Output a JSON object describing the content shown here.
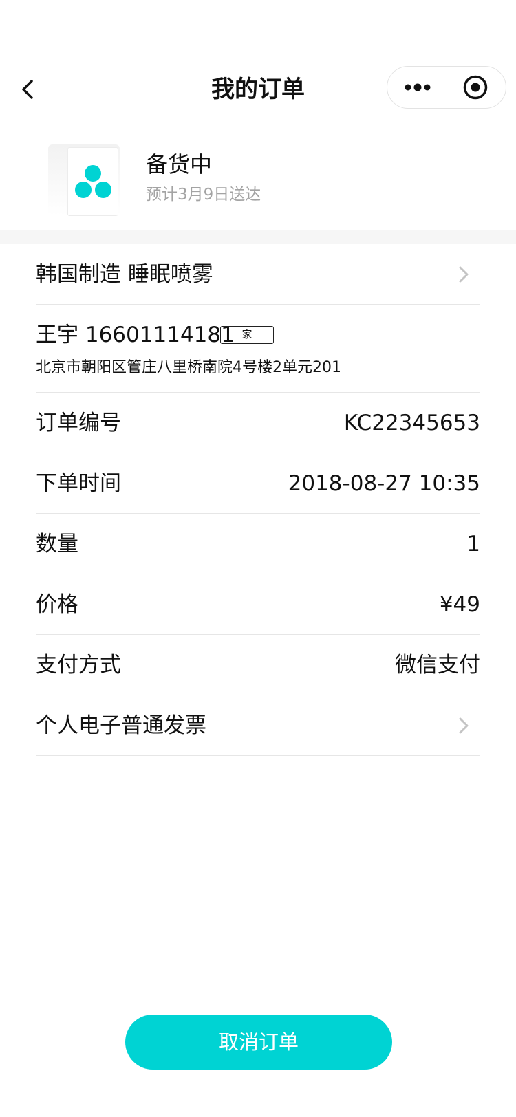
{
  "nav": {
    "title": "我的订单",
    "back_icon": "chevron-left-icon",
    "more_icon": "more-dots-icon",
    "close_icon": "target-circle-icon"
  },
  "order": {
    "status": "备货中",
    "eta": "预计3月9日送达",
    "thumbnail_icon": "three-dots-logo-icon",
    "accent_color": "#00d3d3"
  },
  "product": {
    "name": "韩国制造 睡眠喷雾"
  },
  "address": {
    "name_phone": "王宇 16601114181",
    "tag": "家",
    "line": "北京市朝阳区管庄八里桥南院4号楼2单元201"
  },
  "details": [
    {
      "label": "订单编号",
      "value": "KC22345653"
    },
    {
      "label": "下单时间",
      "value": "2018-08-27 10:35"
    },
    {
      "label": "数量",
      "value": "1"
    },
    {
      "label": "价格",
      "value": "¥49"
    },
    {
      "label": "支付方式",
      "value": "微信支付"
    }
  ],
  "invoice": {
    "label": "个人电子普通发票"
  },
  "actions": {
    "cancel_label": "取消订单"
  }
}
